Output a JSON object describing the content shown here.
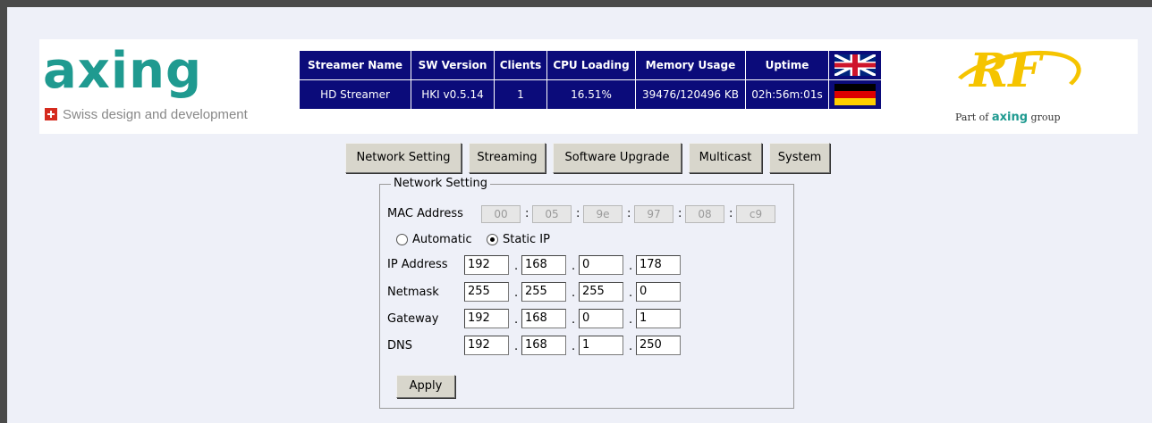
{
  "header": {
    "logo_text": "axing",
    "tagline": "Swiss design and development",
    "status_headers": [
      "Streamer Name",
      "SW Version",
      "Clients",
      "CPU Loading",
      "Memory Usage",
      "Uptime"
    ],
    "status_values": [
      "HD Streamer",
      "HKI v0.5.14",
      "1",
      "16.51%",
      "39476/120496 KB",
      "02h:56m:01s"
    ],
    "languages": [
      "english-flag-icon",
      "german-flag-icon"
    ],
    "rf_logo": {
      "mark": "RF",
      "part_of": "Part of",
      "brand": "axing",
      "group": "group"
    }
  },
  "nav": {
    "tabs": [
      {
        "label": "Network Setting",
        "active": true
      },
      {
        "label": "Streaming"
      },
      {
        "label": "Software Upgrade"
      },
      {
        "label": "Multicast"
      },
      {
        "label": "System"
      }
    ]
  },
  "network": {
    "legend": "Network Setting",
    "mac_label": "MAC Address",
    "mac": [
      "00",
      "05",
      "9e",
      "97",
      "08",
      "c9"
    ],
    "mode_options": [
      {
        "label": "Automatic",
        "checked": false
      },
      {
        "label": "Static IP",
        "checked": true
      }
    ],
    "rows": [
      {
        "label": "IP Address",
        "values": [
          "192",
          "168",
          "0",
          "178"
        ]
      },
      {
        "label": "Netmask",
        "values": [
          "255",
          "255",
          "255",
          "0"
        ]
      },
      {
        "label": "Gateway",
        "values": [
          "192",
          "168",
          "0",
          "1"
        ]
      },
      {
        "label": "DNS",
        "values": [
          "192",
          "168",
          "1",
          "250"
        ]
      }
    ],
    "apply_label": "Apply"
  },
  "colors": {
    "header_bar": "#0b0b7a",
    "brand_teal": "#1f9a90",
    "rf_yellow": "#f5c400",
    "page_bg": "#eef0f8"
  }
}
